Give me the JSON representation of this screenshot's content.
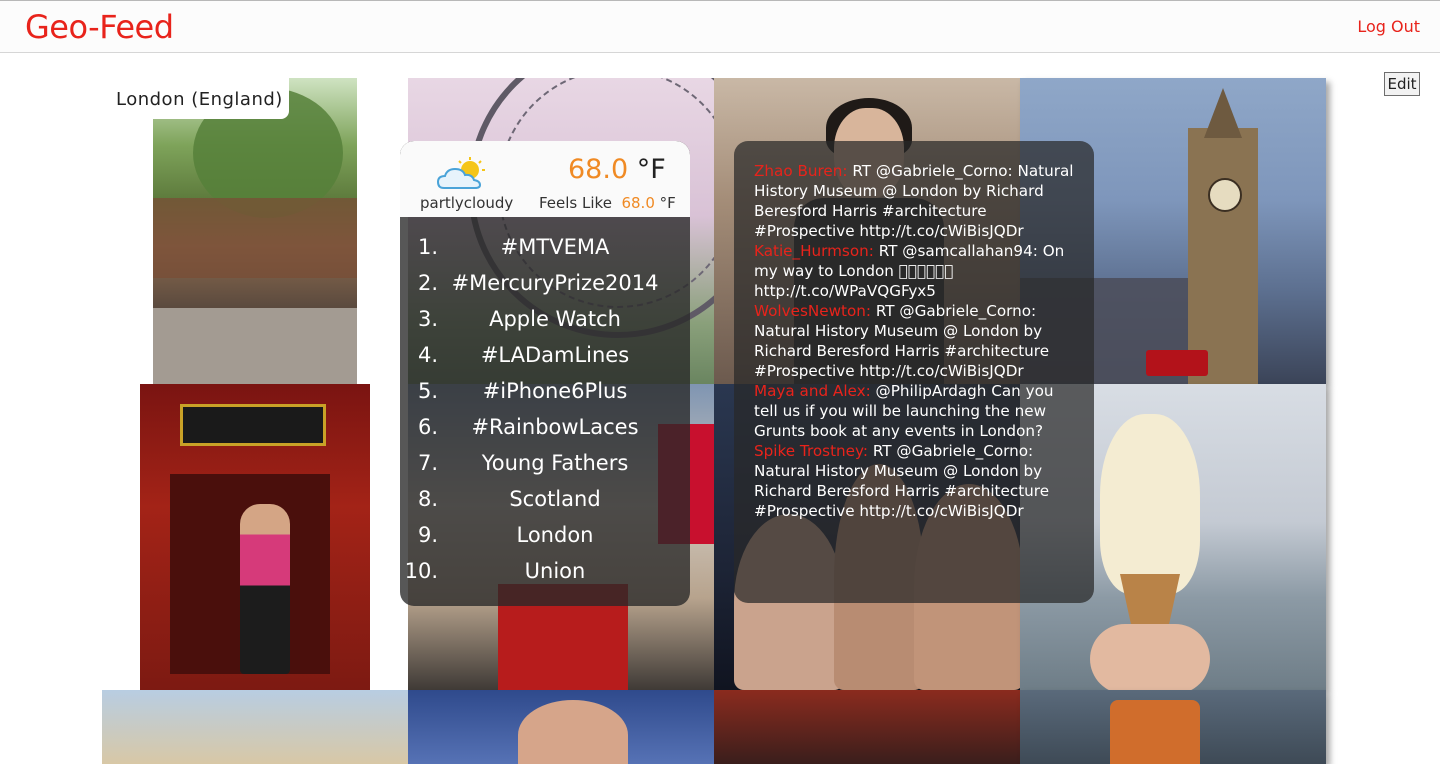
{
  "header": {
    "brand": "Geo-Feed",
    "logout_label": "Log Out"
  },
  "edit_label": "Edit",
  "location": "London (England)",
  "weather": {
    "icon": "partly-cloudy-icon",
    "condition": "partlycloudy",
    "temp": "68.0",
    "unit": "°F",
    "feels_label": "Feels Like",
    "feels_value": "68.0",
    "feels_unit": "°F"
  },
  "trends": [
    {
      "rank": "1.",
      "text": "#MTVEMA"
    },
    {
      "rank": "2.",
      "text": "#MercuryPrize2014"
    },
    {
      "rank": "3.",
      "text": "Apple Watch"
    },
    {
      "rank": "4.",
      "text": "#LADamLines"
    },
    {
      "rank": "5.",
      "text": "#iPhone6Plus"
    },
    {
      "rank": "6.",
      "text": "#RainbowLaces"
    },
    {
      "rank": "7.",
      "text": "Young Fathers"
    },
    {
      "rank": "8.",
      "text": "Scotland"
    },
    {
      "rank": "9.",
      "text": "London"
    },
    {
      "rank": "10.",
      "text": "Union"
    }
  ],
  "tweets": [
    {
      "user": "Zhao Buren:",
      "text": " RT @Gabriele_Corno: Natural History Museum @ London by Richard Beresford Harris #architecture #Prospective http://t.co/cWiBisJQDr"
    },
    {
      "user": "Katie_Hurmson:",
      "text": " RT @samcallahan94: On my way to London 󾌧󾌧󾌧󾌧󾌧󾌧 http://t.co/WPaVQGFyx5"
    },
    {
      "user": "WolvesNewton:",
      "text": " RT @Gabriele_Corno: Natural History Museum @ London by Richard Beresford Harris #architecture #Prospective http://t.co/cWiBisJQDr"
    },
    {
      "user": "Maya and Alex:",
      "text": " @PhilipArdagh Can you tell us if you will be launching the new Grunts book at any events in London?"
    },
    {
      "user": "Spike Trostney:",
      "text": " RT @Gabriele_Corno: Natural History Museum @ London by Richard Beresford Harris #architecture #Prospective http://t.co/cWiBisJQDr"
    }
  ],
  "colors": {
    "brand": "#e8231b",
    "temp": "#f08a24"
  }
}
